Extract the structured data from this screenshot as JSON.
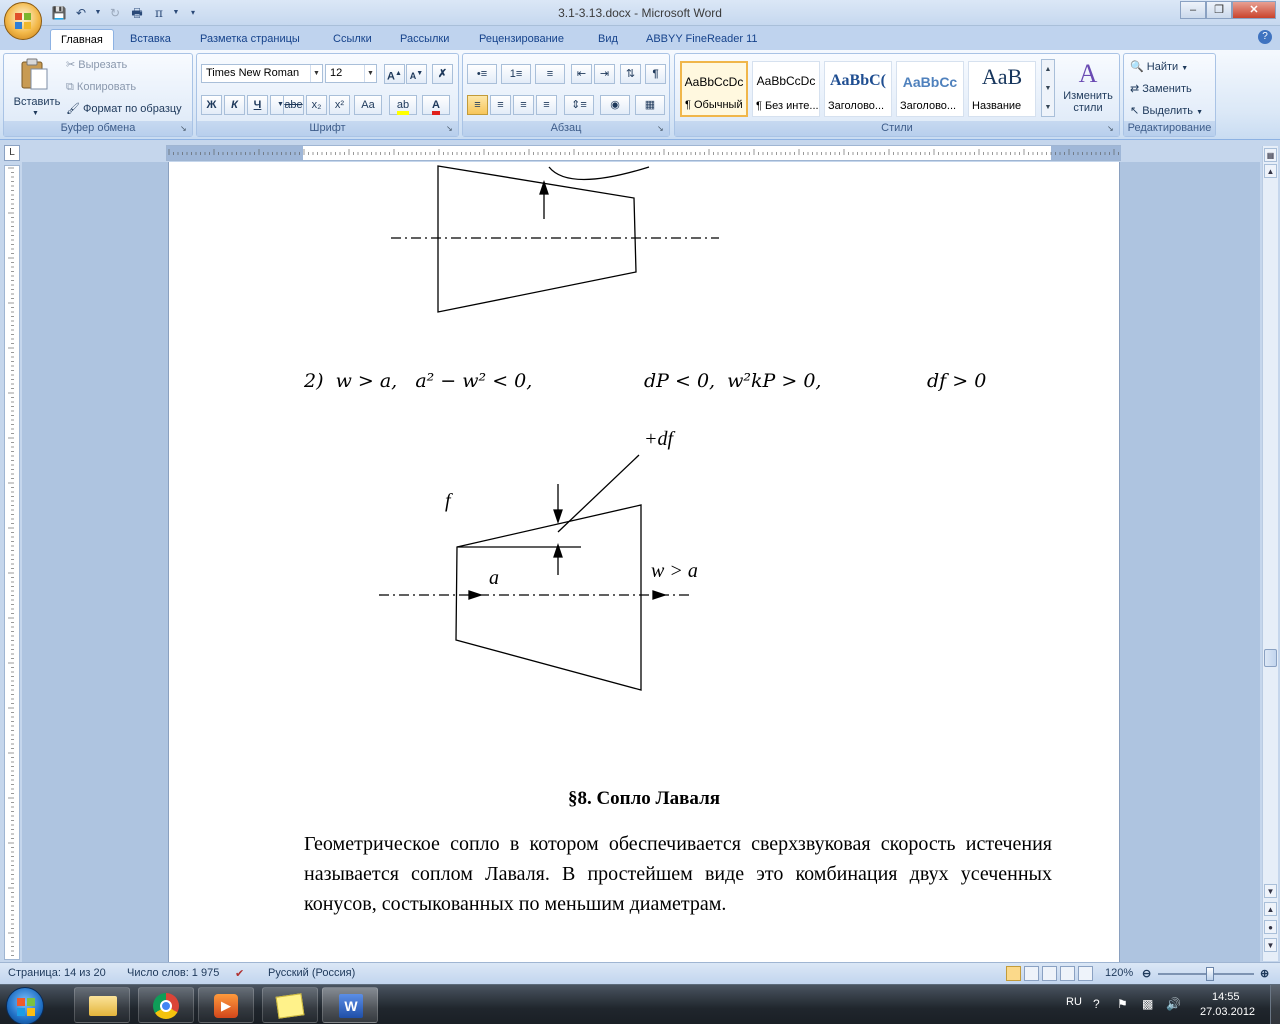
{
  "window": {
    "title": "3.1-3.13.docx - Microsoft Word"
  },
  "tabs": [
    "Главная",
    "Вставка",
    "Разметка страницы",
    "Ссылки",
    "Рассылки",
    "Рецензирование",
    "Вид",
    "ABBYY FineReader 11"
  ],
  "ribbon": {
    "clipboard": {
      "label": "Буфер обмена",
      "paste": "Вставить",
      "cut": "Вырезать",
      "copy": "Копировать",
      "format_painter": "Формат по образцу"
    },
    "font": {
      "label": "Шрифт",
      "name": "Times New Roman",
      "size": "12",
      "bold": "Ж",
      "italic": "К",
      "underline": "Ч",
      "strike": "abe",
      "subscript": "x₂",
      "superscript": "x²",
      "case": "Aa"
    },
    "paragraph": {
      "label": "Абзац"
    },
    "styles": {
      "label": "Стили",
      "items": [
        {
          "sample": "AaBbCcDc",
          "name": "¶ Обычный"
        },
        {
          "sample": "AaBbCcDc",
          "name": "¶ Без инте..."
        },
        {
          "sample": "AaBbC(",
          "name": "Заголово..."
        },
        {
          "sample": "AaBbCc",
          "name": "Заголово..."
        },
        {
          "sample": "AaB",
          "name": "Название"
        }
      ],
      "change": "Изменить стили"
    },
    "editing": {
      "label": "Редактирование",
      "find": "Найти",
      "replace": "Заменить",
      "select": "Выделить"
    }
  },
  "document": {
    "formula_parts": {
      "left": "2)  w > a,   a² − w² < 0,",
      "middle": "dP < 0,  w²kP > 0,",
      "right": "df > 0"
    },
    "figure_labels": {
      "plus_df": "+df",
      "f": "f",
      "a": "a",
      "w_gt_a": "w > a"
    },
    "heading": "§8. Сопло Лаваля",
    "paragraph": "Геометрическое сопло в котором обеспечивается сверхзвуковая скорость истечения называется соплом Лаваля. В простейшем виде это комбинация двух усеченных конусов, состыкованных по меньшим диаметрам."
  },
  "statusbar": {
    "page": "Страница: 14 из 20",
    "words": "Число слов: 1 975",
    "language": "Русский (Россия)",
    "zoom": "120%"
  },
  "taskbar": {
    "lang": "RU",
    "time": "14:55",
    "date": "27.03.2012"
  }
}
